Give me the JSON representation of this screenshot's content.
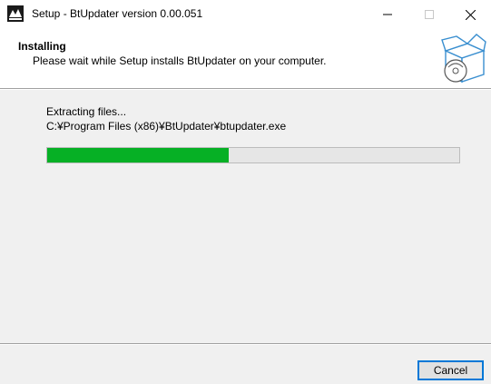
{
  "window": {
    "title": "Setup - BtUpdater version 0.00.051",
    "app_icon": "setup-app-icon",
    "controls": {
      "minimize_icon": "minimize-icon",
      "maximize_icon": "maximize-icon",
      "close_icon": "close-icon"
    }
  },
  "header": {
    "title": "Installing",
    "subtitle": "Please wait while Setup installs BtUpdater on your computer.",
    "graphic": "install-box-icon"
  },
  "main": {
    "status_text": "Extracting files...",
    "current_file": "C:¥Program Files (x86)¥BtUpdater¥btupdater.exe",
    "progress_fraction": 0.44,
    "progress_color": "#06b025"
  },
  "footer": {
    "cancel_label": "Cancel"
  },
  "colors": {
    "accent": "#0078d7",
    "panel_bg": "#f0f0f0",
    "progress_track": "#e6e6e6"
  }
}
